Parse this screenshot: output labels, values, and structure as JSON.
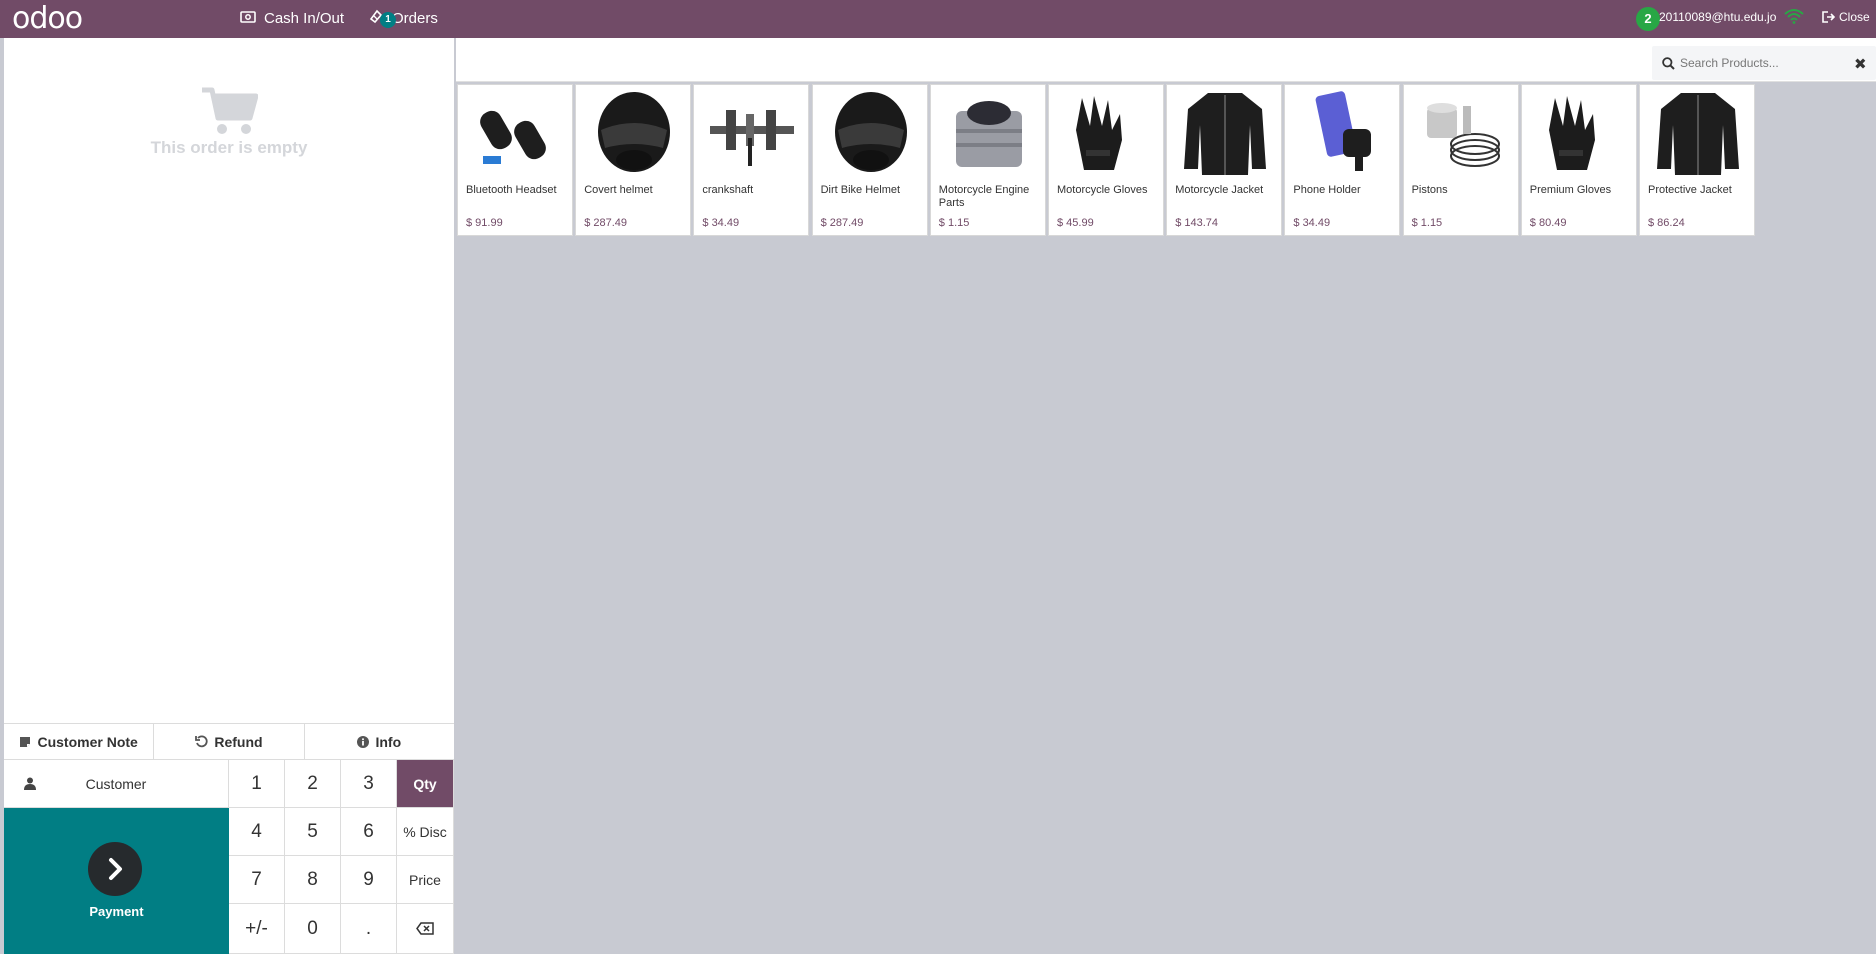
{
  "brand": {
    "logo": "odoo",
    "color": "#714b67",
    "accent": "#017e84"
  },
  "header": {
    "cash_label": "Cash In/Out",
    "orders_label": "Orders",
    "orders_count": "1",
    "cashier_count": "2",
    "cashier_name": "20110089@htu.edu.jo",
    "close_label": "Close"
  },
  "order": {
    "empty_text": "This order is empty"
  },
  "controls": {
    "customer_note": "Customer Note",
    "refund": "Refund",
    "info": "Info",
    "customer": "Customer",
    "payment": "Payment"
  },
  "numpad": {
    "k1": "1",
    "k2": "2",
    "k3": "3",
    "qty": "Qty",
    "k4": "4",
    "k5": "5",
    "k6": "6",
    "disc": "% Disc",
    "k7": "7",
    "k8": "8",
    "k9": "9",
    "price": "Price",
    "plusminus": "+/-",
    "k0": "0",
    "dot": "."
  },
  "search": {
    "placeholder": "Search Products..."
  },
  "products": [
    {
      "name": "Bluetooth Headset",
      "price": "$ 91.99",
      "icon": "headset"
    },
    {
      "name": "Covert helmet",
      "price": "$ 287.49",
      "icon": "helmet"
    },
    {
      "name": "crankshaft",
      "price": "$ 34.49",
      "icon": "crankshaft"
    },
    {
      "name": "Dirt Bike Helmet",
      "price": "$ 287.49",
      "icon": "helmet"
    },
    {
      "name": "Motorcycle Engine Parts",
      "price": "$ 1.15",
      "icon": "engine"
    },
    {
      "name": "Motorcycle Gloves",
      "price": "$ 45.99",
      "icon": "gloves"
    },
    {
      "name": "Motorcycle Jacket",
      "price": "$ 143.74",
      "icon": "jacket"
    },
    {
      "name": "Phone Holder",
      "price": "$ 34.49",
      "icon": "phone"
    },
    {
      "name": "Pistons",
      "price": "$ 1.15",
      "icon": "piston"
    },
    {
      "name": "Premium Gloves",
      "price": "$ 80.49",
      "icon": "gloves"
    },
    {
      "name": "Protective Jacket",
      "price": "$ 86.24",
      "icon": "jacket"
    }
  ]
}
